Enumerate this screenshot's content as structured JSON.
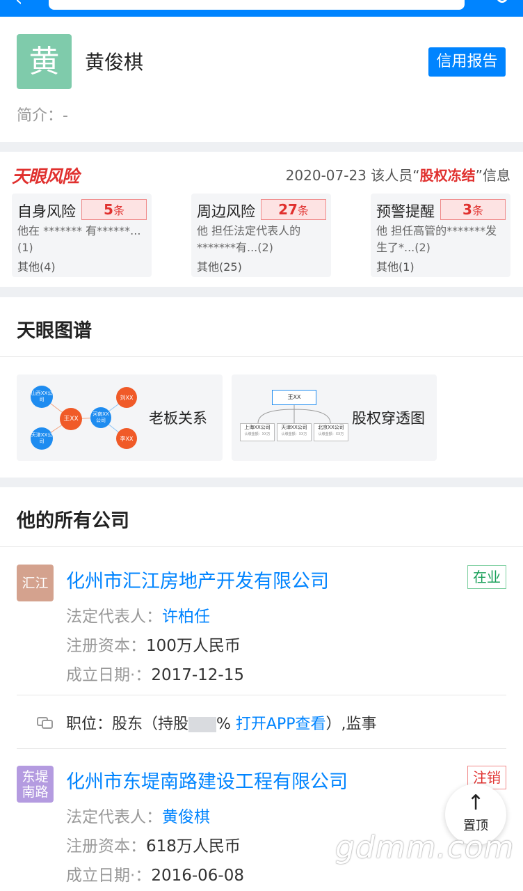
{
  "profile": {
    "avatar_char": "黄",
    "name": "黄俊棋",
    "credit_report": "信用报告",
    "intro": "简介：-"
  },
  "risk": {
    "logo": "天眼风险",
    "notice_pre": "2020-07-23 该人员“",
    "notice_hl": "股权冻结",
    "notice_post": "”信息",
    "cards": [
      {
        "title": "自身风险",
        "count": "5",
        "unit": "条",
        "desc": "他在 ******* 有******...(1)",
        "other": "其他(4)"
      },
      {
        "title": "周边风险",
        "count": "27",
        "unit": "条",
        "desc": "他 担任法定代表人的 *******有...(2)",
        "other": "其他(25)"
      },
      {
        "title": "预警提醒",
        "count": "3",
        "unit": "条",
        "desc": "他 担任高管的*******发生了*...(2)",
        "other": "其他(1)"
      }
    ]
  },
  "graph": {
    "title": "天眼图谱",
    "boss_label": "老板关系",
    "equity_label": "股权穿透图",
    "boss_nodes": {
      "center": "王XX",
      "n1": "山西XX公司",
      "n2": "天津XX公司",
      "n3": "河南XX公司",
      "n4": "刘XX",
      "n5": "李XX"
    },
    "equity_nodes": {
      "top": "王XX",
      "c1": "上海XX公司",
      "c2": "天津XX公司",
      "c3": "北京XX公司",
      "sub": "认缴金额：XX万"
    }
  },
  "companies": {
    "title": "他的所有公司",
    "items": [
      {
        "logo": "汇江",
        "name": "化州市汇江房地产开发有限公司",
        "status": "在业",
        "legal_label": "法定代表人：",
        "legal": "许柏任",
        "capital_label": "注册资本：",
        "capital": "100万人民币",
        "date_label": "成立日期·：",
        "date": "2017-12-15"
      },
      {
        "logo": "东堤\n南路",
        "name": "化州市东堤南路建设工程有限公司",
        "status": "注销",
        "legal_label": "法定代表人：",
        "legal": "黄俊棋",
        "capital_label": "注册资本：",
        "capital": "618万人民币",
        "date_label": "成立日期·：",
        "date": "2016-06-08"
      }
    ],
    "position": {
      "pre": "职位：股东（持股",
      "pct": "%",
      "link": "打开APP查看",
      "post": "）,监事"
    }
  },
  "to_top": {
    "arrow": "↑",
    "label": "置顶"
  },
  "watermark": "gdmm.com",
  "colors": {
    "brand_blue": "#0084ff",
    "risk_red": "#e0302e",
    "status_green": "#1aa05a",
    "avatar_green": "#7fcbab",
    "logo_tan": "#d4a28e",
    "logo_purple": "#b49be0"
  }
}
